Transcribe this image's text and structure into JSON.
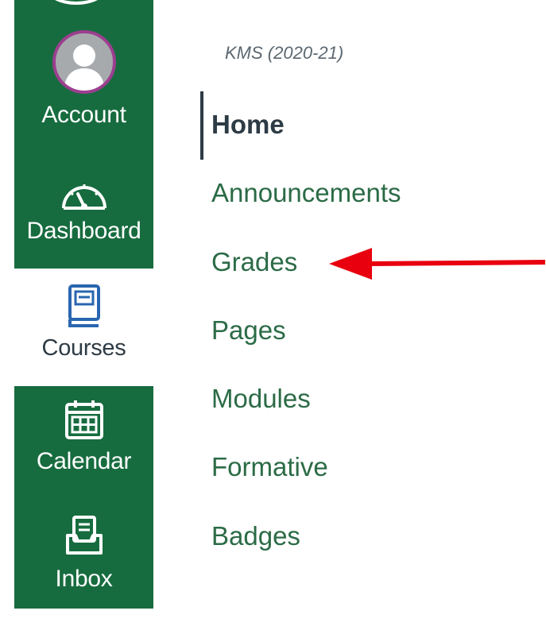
{
  "global_nav": {
    "account": {
      "label": "Account",
      "icon": "user-avatar-icon"
    },
    "dashboard": {
      "label": "Dashboard",
      "icon": "speedometer-icon"
    },
    "courses": {
      "label": "Courses",
      "icon": "book-icon"
    },
    "calendar": {
      "label": "Calendar",
      "icon": "calendar-icon"
    },
    "inbox": {
      "label": "Inbox",
      "icon": "inbox-icon"
    }
  },
  "course_nav": {
    "term": "KMS (2020-21)",
    "links": [
      {
        "label": "Home",
        "active": true
      },
      {
        "label": "Announcements",
        "active": false
      },
      {
        "label": "Grades",
        "active": false
      },
      {
        "label": "Pages",
        "active": false
      },
      {
        "label": "Modules",
        "active": false
      },
      {
        "label": "Formative",
        "active": false
      },
      {
        "label": "Badges",
        "active": false
      }
    ]
  },
  "annotation": {
    "arrow_color": "#e8000f",
    "points_to": "Grades"
  },
  "colors": {
    "nav_green": "#176c3f",
    "link_green": "#2b6b46",
    "text_dark": "#2d3b45",
    "avatar_ring": "#9c3e8f"
  }
}
